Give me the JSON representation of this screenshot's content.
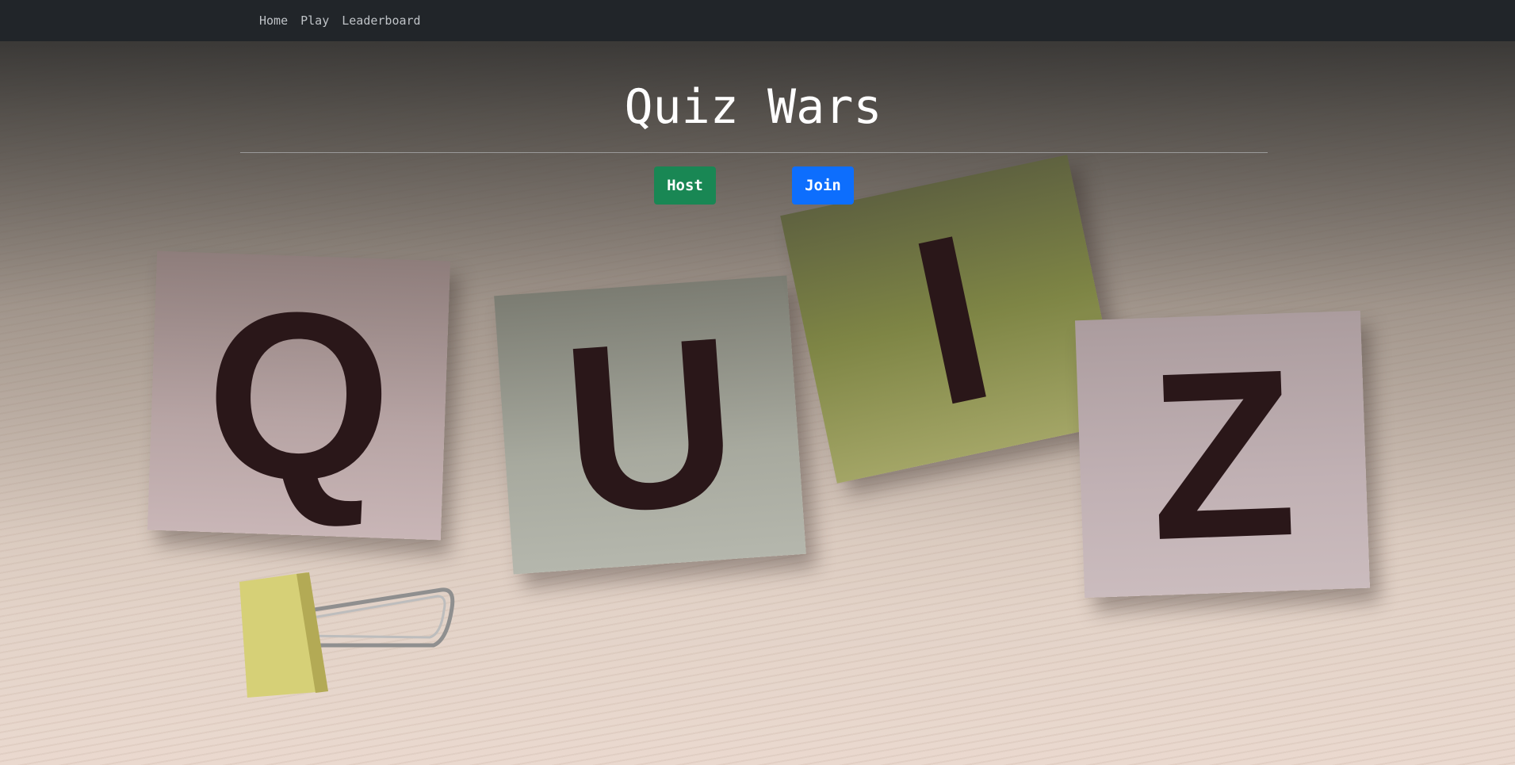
{
  "nav": {
    "links": [
      "Home",
      "Play",
      "Leaderboard"
    ]
  },
  "hero": {
    "title": "Quiz Wars",
    "host_label": "Host",
    "join_label": "Join"
  },
  "background": {
    "letters": [
      "Q",
      "U",
      "I",
      "Z"
    ],
    "clip_icon": "binder-clip-icon"
  },
  "colors": {
    "navbar": "#212529",
    "host_button": "#198754",
    "join_button": "#0d6efd"
  }
}
